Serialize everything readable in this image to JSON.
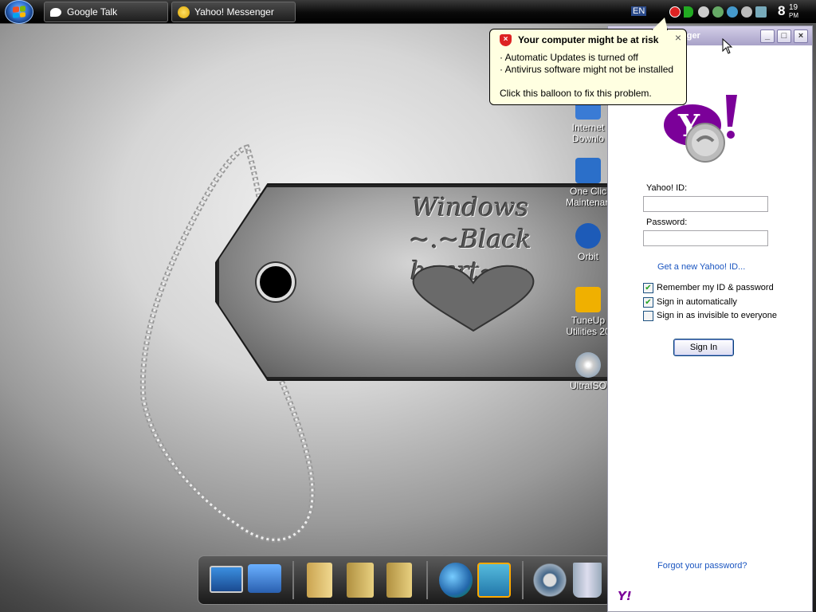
{
  "taskbar": {
    "tasks": [
      {
        "label": "Google Talk",
        "icon": "google-talk-icon"
      },
      {
        "label": "Yahoo! Messenger",
        "icon": "yahoo-messenger-icon"
      }
    ],
    "language": "EN",
    "clock": {
      "hour": "8",
      "minute": "19",
      "ampm": "PM"
    }
  },
  "wallpaper": {
    "title_line1": "Windows",
    "title_line2": "~.~Black heart~.~"
  },
  "desktop_icons": [
    {
      "label_line1": "Internet",
      "label_line2": "Downlo",
      "icon": "internet-download-manager-icon"
    },
    {
      "label_line1": "One Clic",
      "label_line2": "Maintenan",
      "icon": "one-click-maintenance-icon"
    },
    {
      "label_line1": "Orbit",
      "label_line2": "",
      "icon": "orbit-icon"
    },
    {
      "label_line1": "TuneUp",
      "label_line2": "Utilities 20",
      "icon": "tuneup-utilities-icon"
    },
    {
      "label_line1": "UltraISO",
      "label_line2": "",
      "icon": "ultraiso-icon"
    }
  ],
  "balloon": {
    "title": "Your computer might be at risk",
    "line1": "· Automatic Updates is turned off",
    "line2": "· Antivirus software might not be installed",
    "line3": "Click this balloon to fix this problem.",
    "close": "×"
  },
  "yahoo_window": {
    "title": "nger",
    "yahoo_id_label": "Yahoo! ID:",
    "yahoo_id_value": "",
    "password_label": "Password:",
    "password_value": "",
    "new_id_link": "Get a new Yahoo! ID...",
    "remember_label": "Remember my ID & password",
    "remember_checked": true,
    "auto_signin_label": "Sign in automatically",
    "auto_signin_checked": true,
    "invisible_label": "Sign in as invisible to everyone",
    "invisible_checked": false,
    "signin_button": "Sign In",
    "forgot_link": "Forgot your password?",
    "footer_logo": "Y!"
  },
  "colors": {
    "yahoo_purple": "#7b0099",
    "link_blue": "#1a55c0",
    "balloon_bg": "#ffffe1",
    "shield_red": "#dd2222"
  }
}
